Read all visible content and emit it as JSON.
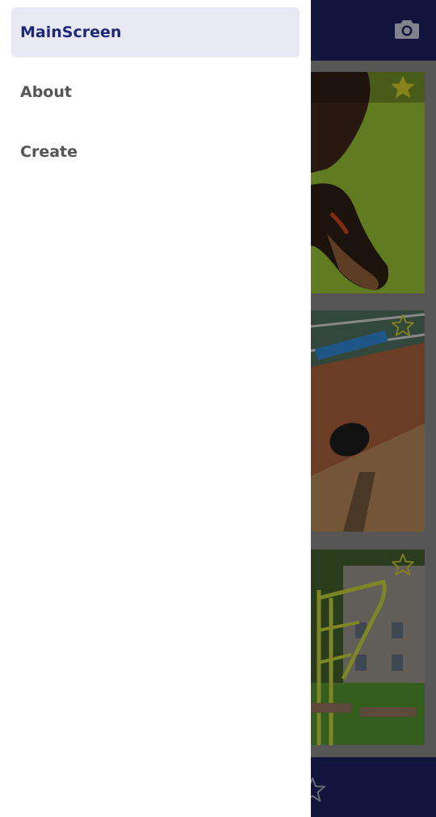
{
  "drawer": {
    "items": [
      {
        "label": "MainScreen",
        "active": true
      },
      {
        "label": "About",
        "active": false
      },
      {
        "label": "Create",
        "active": false
      }
    ]
  },
  "app": {
    "camera_icon": "camera-icon",
    "photos": [
      {
        "subject": "dog on green blanket",
        "favorite": true
      },
      {
        "subject": "foosball table",
        "favorite": false
      },
      {
        "subject": "outdoor exercise bars",
        "favorite": false
      }
    ],
    "bottom_icon": "star-outline-icon"
  },
  "colors": {
    "appbar": "#1a1f5c",
    "active_item_bg": "#e8e9f4",
    "active_item_text": "#1d2878",
    "star": "#c8c02a"
  }
}
